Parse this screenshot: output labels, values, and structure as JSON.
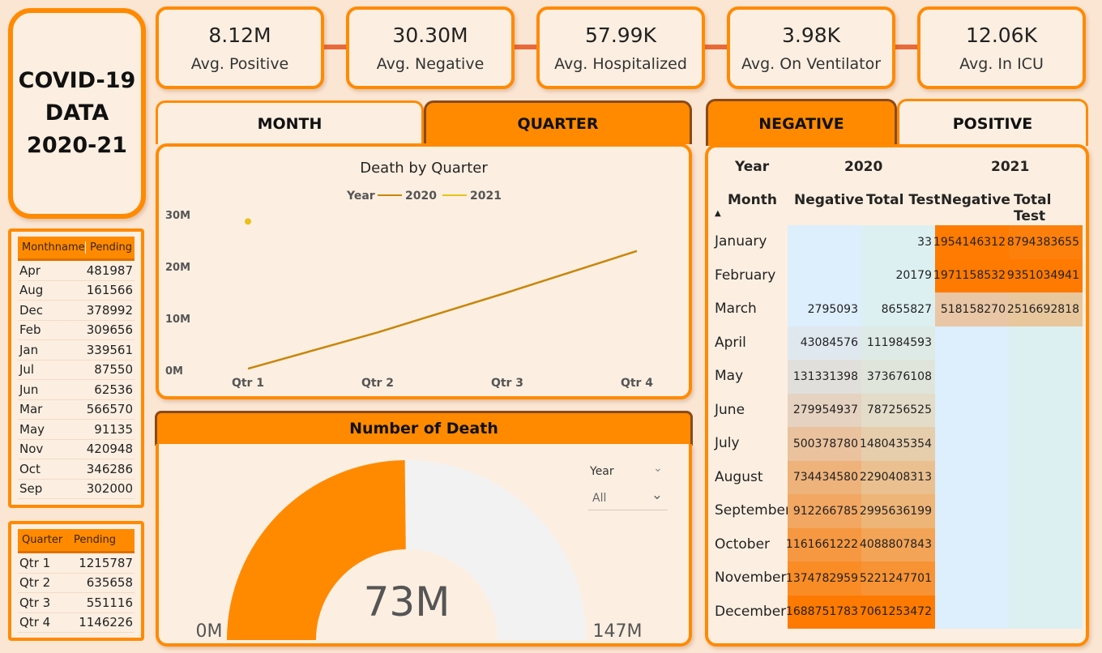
{
  "title": {
    "line1": "COVID-19",
    "line2": "DATA",
    "line3": "2020-21"
  },
  "kpis": [
    {
      "value": "8.12M",
      "label": "Avg. Positive"
    },
    {
      "value": "30.30M",
      "label": "Avg. Negative"
    },
    {
      "value": "57.99K",
      "label": "Avg. Hospitalized"
    },
    {
      "value": "3.98K",
      "label": "Avg. On Ventilator"
    },
    {
      "value": "12.06K",
      "label": "Avg. In ICU"
    }
  ],
  "month_table": {
    "headers": [
      "Monthname",
      "Pending"
    ],
    "rows": [
      [
        "Apr",
        "481987"
      ],
      [
        "Aug",
        "161566"
      ],
      [
        "Dec",
        "378992"
      ],
      [
        "Feb",
        "309656"
      ],
      [
        "Jan",
        "339561"
      ],
      [
        "Jul",
        "87550"
      ],
      [
        "Jun",
        "62536"
      ],
      [
        "Mar",
        "566570"
      ],
      [
        "May",
        "91135"
      ],
      [
        "Nov",
        "420948"
      ],
      [
        "Oct",
        "346286"
      ],
      [
        "Sep",
        "302000"
      ]
    ]
  },
  "quarter_table": {
    "headers": [
      "Quarter",
      "Pending"
    ],
    "rows": [
      [
        "Qtr 1",
        "1215787"
      ],
      [
        "Qtr 2",
        "635658"
      ],
      [
        "Qtr 3",
        "551116"
      ],
      [
        "Qtr 4",
        "1146226"
      ]
    ]
  },
  "left_tabs": {
    "month": "MONTH",
    "quarter": "QUARTER"
  },
  "right_tabs": {
    "negative": "NEGATIVE",
    "positive": "POSITIVE"
  },
  "chart_data": {
    "type": "line",
    "title": "Death by Quarter",
    "legend_title": "Year",
    "categories": [
      "Qtr 1",
      "Qtr 2",
      "Qtr 3",
      "Qtr 4"
    ],
    "series": [
      {
        "name": "2020",
        "color": "#c8860a",
        "values": [
          0.3,
          7.3,
          15.0,
          23.0
        ]
      },
      {
        "name": "2021",
        "color": "#e8c21a",
        "values": [
          28.7,
          null,
          null,
          null
        ]
      }
    ],
    "yticks": [
      "0M",
      "10M",
      "20M",
      "30M"
    ],
    "ylim": [
      0,
      30
    ],
    "legend_position": "top-center",
    "grid": false
  },
  "gauge": {
    "title": "Number of Death",
    "value": 73,
    "value_label": "73M",
    "min": 0,
    "min_label": "0M",
    "max": 147,
    "max_label": "147M",
    "fill_color": "#ff8a00",
    "track_color": "#f2f2f2",
    "slicer_label": "Year",
    "slicer_value": "All"
  },
  "matrix": {
    "year_header": "Year",
    "month_header": "Month",
    "years": [
      "2020",
      "2021"
    ],
    "columns": [
      "Negative",
      "Total Test",
      "Negative",
      "Total Test"
    ],
    "rows": [
      {
        "month": "January",
        "cells": [
          "",
          "33",
          "1954146312",
          "8794383655"
        ]
      },
      {
        "month": "February",
        "cells": [
          "",
          "20179",
          "1971158532",
          "9351034941"
        ]
      },
      {
        "month": "March",
        "cells": [
          "2795093",
          "8655827",
          "518158270",
          "2516692818"
        ]
      },
      {
        "month": "April",
        "cells": [
          "43084576",
          "111984593",
          "",
          ""
        ]
      },
      {
        "month": "May",
        "cells": [
          "131331398",
          "373676108",
          "",
          ""
        ]
      },
      {
        "month": "June",
        "cells": [
          "279954937",
          "787256525",
          "",
          ""
        ]
      },
      {
        "month": "July",
        "cells": [
          "500378780",
          "1480435354",
          "",
          ""
        ]
      },
      {
        "month": "August",
        "cells": [
          "734434580",
          "2290408313",
          "",
          ""
        ]
      },
      {
        "month": "September",
        "cells": [
          "912266785",
          "2995636199",
          "",
          ""
        ]
      },
      {
        "month": "October",
        "cells": [
          "1161661222",
          "4088807843",
          "",
          ""
        ]
      },
      {
        "month": "November",
        "cells": [
          "1374782959",
          "5221247701",
          "",
          ""
        ]
      },
      {
        "month": "December",
        "cells": [
          "1688751783",
          "7061253472",
          "",
          ""
        ]
      }
    ]
  }
}
